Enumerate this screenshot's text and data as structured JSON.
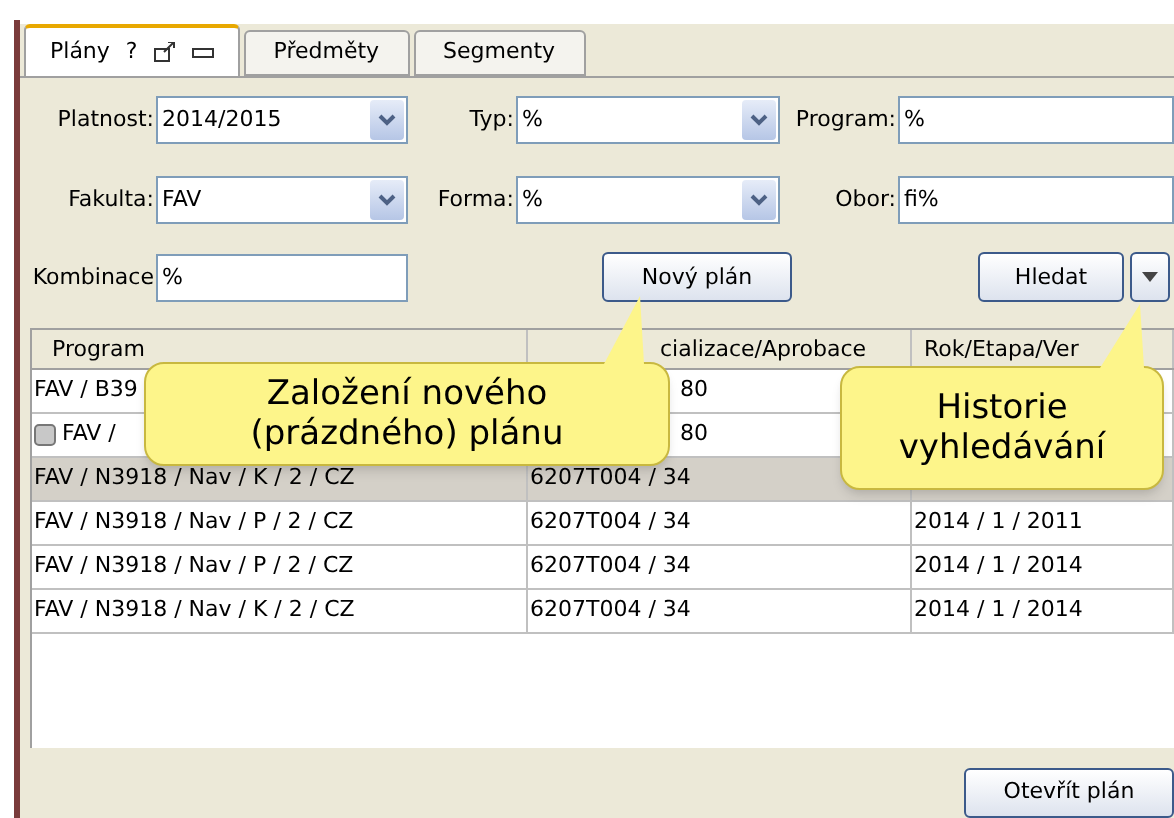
{
  "tabs": [
    {
      "label": "Plány",
      "help": "?",
      "selected": true
    },
    {
      "label": "Předměty",
      "selected": false
    },
    {
      "label": "Segmenty",
      "selected": false
    }
  ],
  "filters": [
    {
      "label": "Platnost:",
      "value": "2014/2015",
      "kind": "combo"
    },
    {
      "label": "Typ:",
      "value": "%",
      "kind": "combo"
    },
    {
      "label": "Program:",
      "value": "%",
      "kind": "text"
    },
    {
      "label": "Fakulta:",
      "value": "FAV",
      "kind": "combo"
    },
    {
      "label": "Forma:",
      "value": "%",
      "kind": "combo"
    },
    {
      "label": "Obor:",
      "value": "fi%",
      "kind": "text"
    },
    {
      "label": "Kombinace",
      "value": "%",
      "kind": "text"
    }
  ],
  "buttons": {
    "new_plan": "Nový plán",
    "search": "Hledat",
    "open_plan": "Otevřít plán"
  },
  "table": {
    "columns": [
      "Program",
      "cializace/Aprobace",
      "Rok/Etapa/Ver"
    ],
    "rows": [
      {
        "cells": [
          "FAV / B39",
          "80",
          ""
        ],
        "selected": false,
        "icon": false
      },
      {
        "cells": [
          "FAV /",
          "80",
          ""
        ],
        "selected": false,
        "icon": true
      },
      {
        "cells": [
          "FAV / N3918 / Nav / K / 2 / CZ",
          "6207T004 / 34",
          ""
        ],
        "selected": true,
        "icon": false
      },
      {
        "cells": [
          "FAV / N3918 / Nav / P / 2 / CZ",
          "6207T004 / 34",
          "2014 / 1 / 2011"
        ],
        "selected": false,
        "icon": false
      },
      {
        "cells": [
          "FAV / N3918 / Nav / P / 2 / CZ",
          "6207T004 / 34",
          "2014 / 1 / 2014"
        ],
        "selected": false,
        "icon": false
      },
      {
        "cells": [
          "FAV / N3918 / Nav / K / 2 / CZ",
          "6207T004 / 34",
          "2014 / 1 / 2014"
        ],
        "selected": false,
        "icon": false
      }
    ]
  },
  "callouts": [
    "Založení nového (prázdného) plánu",
    "Historie vyhledávání"
  ]
}
